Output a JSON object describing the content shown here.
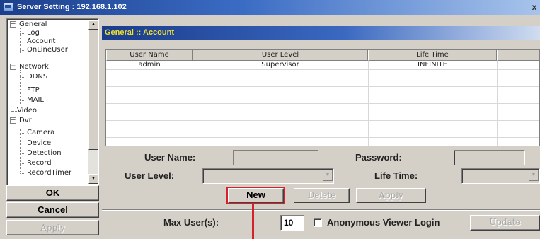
{
  "window": {
    "title": "Server Setting : 192.168.1.102",
    "close_label": "x"
  },
  "tree": {
    "items": [
      {
        "label": "General",
        "expanded": true,
        "level": 0
      },
      {
        "label": "Log",
        "level": 1
      },
      {
        "label": "Account",
        "level": 1,
        "selected": true
      },
      {
        "label": "OnLineUser",
        "level": 1
      },
      {
        "label": "Network",
        "expanded": true,
        "level": 0
      },
      {
        "label": "DDNS",
        "level": 1
      },
      {
        "label": "FTP",
        "level": 1
      },
      {
        "label": "MAIL",
        "level": 1
      },
      {
        "label": "Video",
        "level": 0
      },
      {
        "label": "Dvr",
        "expanded": true,
        "level": 0
      },
      {
        "label": "Camera",
        "level": 1
      },
      {
        "label": "Device",
        "level": 1
      },
      {
        "label": "Detection",
        "level": 1
      },
      {
        "label": "Record",
        "level": 1
      },
      {
        "label": "RecordTimer",
        "level": 1
      }
    ],
    "expander_minus": "−",
    "scroll_up": "▲",
    "scroll_down": "▼"
  },
  "left_buttons": {
    "ok": "OK",
    "cancel": "Cancel",
    "apply": "Apply"
  },
  "section": {
    "title": "General :: Account"
  },
  "table": {
    "columns": [
      "User Name",
      "User Level",
      "Life Time",
      ""
    ],
    "rows": [
      [
        "admin",
        "Supervisor",
        "INFINITE",
        ""
      ]
    ]
  },
  "form": {
    "user_name_label": "User Name:",
    "user_name_value": "",
    "password_label": "Password:",
    "password_value": "",
    "user_level_label": "User Level:",
    "user_level_value": "",
    "life_time_label": "Life Time:",
    "life_time_value": "",
    "combo_arrow": "▼",
    "new_button": "New",
    "delete_button": "Delete",
    "apply_button": "Apply",
    "max_users_label": "Max User(s):",
    "max_users_value": "10",
    "anonymous_label": "Anonymous Viewer Login",
    "anonymous_checked": false,
    "update_button": "Update"
  },
  "annotation": {
    "color": "#d8202a",
    "highlight_target": "New"
  }
}
